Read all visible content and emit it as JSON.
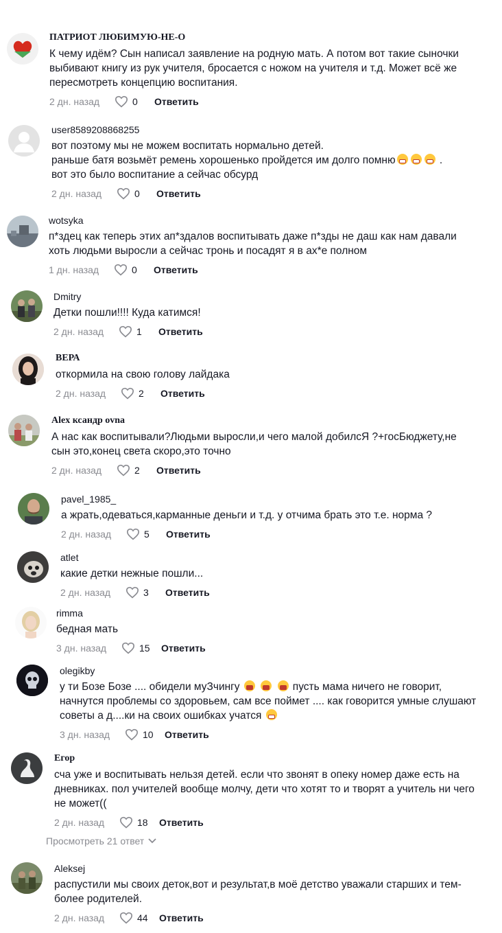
{
  "comments": [
    {
      "username": "ПАТРИОТ ЛЮБИМУЮ-НЕ-О",
      "text": "К чему идём? Сын написал заявление на родную мать. А потом вот такие сыночки\nвыбивают книгу из рук учителя, бросается с ножом на учителя и т.д. Может всё же\nпересмотреть концепцию воспитания.",
      "date": "2 дн. назад",
      "likes": "0",
      "reply": "Ответить",
      "avatar_icon": "heart-flag-avatar-icon"
    },
    {
      "username": "user8589208868255",
      "text_before": "вот поэтому мы не можем воспитать нормально детей.\nраньше батя возьмёт ремень хорошенько пройдется им долго помню",
      "text_after": " .\nвот это было воспитание а сейчас обсурд",
      "date": "2 дн. назад",
      "likes": "0",
      "reply": "Ответить",
      "avatar_icon": "default-user-avatar-icon"
    },
    {
      "username": "wotsyka",
      "text": "п*здец как теперь этих ап*здалов воспитывать даже п*зды не даш как нам давали\nхоть людьми выросли а сейчас тронь и посадят я в ах*е полном",
      "date": "1 дн. назад",
      "likes": "0",
      "reply": "Ответить",
      "avatar_icon": "landscape-avatar-icon"
    },
    {
      "username": "Dmitry",
      "text": "Детки пошли!!!! Куда катимся!",
      "date": "2 дн. назад",
      "likes": "1",
      "reply": "Ответить",
      "avatar_icon": "group-photo-avatar-icon"
    },
    {
      "username": "ВЕРА",
      "text": "откормила на свою голову лайдака",
      "date": "2 дн. назад",
      "likes": "2",
      "reply": "Ответить",
      "avatar_icon": "woman-portrait-avatar-icon"
    },
    {
      "username": "Alex ксандр ovna",
      "text": "А нас как воспитывали?Людьми выросли,и чего малой добилсЯ ?+госБюджету,не\nсын это,конец света скоро,это точно",
      "date": "2 дн. назад",
      "likes": "2",
      "reply": "Ответить",
      "avatar_icon": "family-photo-avatar-icon"
    },
    {
      "username": "pavel_1985_",
      "text": "а жрать,одеваться,карманные деньги и т.д. у отчима брать это т.е. норма ?",
      "date": "2 дн. назад",
      "likes": "5",
      "reply": "Ответить",
      "avatar_icon": "man-portrait-avatar-icon"
    },
    {
      "username": "atlet",
      "text": "какие детки нежные пошли...",
      "date": "2 дн. назад",
      "likes": "3",
      "reply": "Ответить",
      "avatar_icon": "cat-avatar-icon"
    },
    {
      "username": "rimma",
      "text": "бедная мать",
      "date": "3 дн. назад",
      "likes": "15",
      "reply": "Ответить",
      "avatar_icon": "blonde-woman-avatar-icon"
    },
    {
      "username": "olegikby",
      "text_before": "у ти Бозе Бозе .... обидели муЗчингу ",
      "text_mid": " пусть мама ничего не говорит,\nначнутся проблемы со здоровьем, сам все поймет .... как говорится умные слушают\nсоветы а д....ки на своих ошибках учатся ",
      "date": "3 дн. назад",
      "likes": "10",
      "reply": "Ответить",
      "avatar_icon": "skull-avatar-icon"
    },
    {
      "username": "Егор",
      "text": "сча уже и воспитывать нельзя детей. если что звонят в опеку номер даже есть на\nдневниках. пол учителей вообще молчу, дети что хотят то и творят а учитель ни чего\nне может((",
      "date": "2 дн. назад",
      "likes": "18",
      "reply": "Ответить",
      "avatar_icon": "swan-avatar-icon"
    },
    {
      "username": "Aleksej",
      "text": "распустили мы своих деток,вот и результат,в моё детство уважали старших и тем-\nболее родителей.",
      "date": "2 дн. назад",
      "likes": "44",
      "reply": "Ответить",
      "avatar_icon": "soldiers-avatar-icon"
    }
  ],
  "view_replies": {
    "label": "Просмотреть 21 ответ",
    "icon": "chevron-down-icon"
  },
  "colors": {
    "text": "#161823",
    "muted": "#8a8b91",
    "background": "#ffffff"
  }
}
